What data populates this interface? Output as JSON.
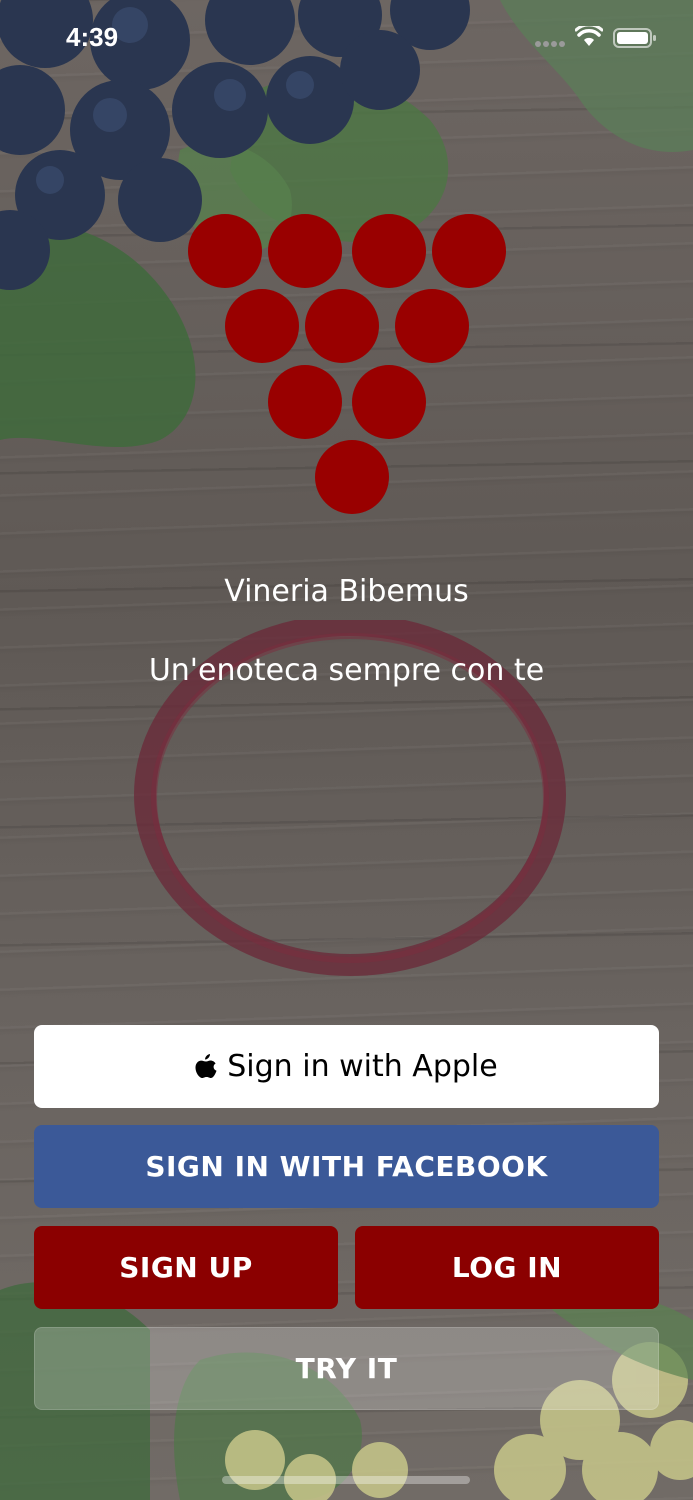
{
  "status_bar": {
    "time": "4:39",
    "signal_icon": "cellular-signal-icon",
    "wifi_icon": "wifi-icon",
    "battery_icon": "battery-icon"
  },
  "brand": {
    "logo_icon": "grape-cluster-logo-icon",
    "title": "Vineria Bibemus",
    "tagline": "Un'enoteca sempre con te"
  },
  "buttons": {
    "apple_label": "Sign in with Apple",
    "facebook_label": "SIGN IN WITH FACEBOOK",
    "signup_label": "SIGN UP",
    "login_label": "LOG IN",
    "try_label": "TRY IT"
  },
  "colors": {
    "brand_red": "#8b0000",
    "facebook_blue": "#3b5998",
    "apple_button_bg": "#ffffff",
    "text_light": "#ffffff"
  }
}
